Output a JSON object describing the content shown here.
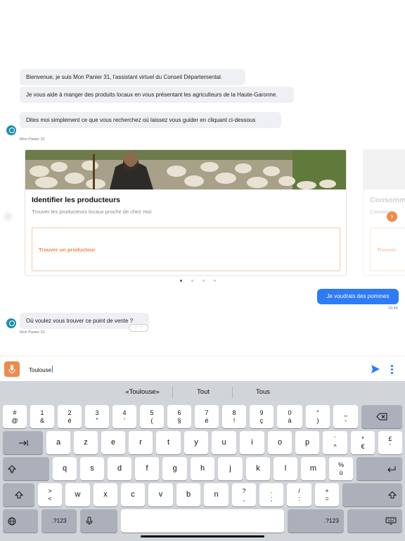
{
  "chat": {
    "bot_name": "Mon Panier 31",
    "messages": [
      {
        "text": "Bienvenue, je suis Mon Panier 31, l'assistant virtuel du Conseil Départemental."
      },
      {
        "text": "Je vous aide à manger des produits locaux en vous présentant les agriculteurs de la Haute-Garonne."
      },
      {
        "text": "Dites moi simplement ce que vous recherchez où laissez vous guider en cliquant ci-dessous"
      }
    ],
    "carousel": {
      "cards": [
        {
          "title": "Identifier les producteurs",
          "description": "Trouver les producteurs locaux proche de chez moi",
          "button": "Trouver un producteur"
        },
        {
          "title": "Consomm",
          "description": "Consom",
          "button": "Trouver"
        }
      ],
      "page_count": 4,
      "active_index": 0
    },
    "user_message": {
      "text": "Je voudrais des pommes",
      "time": "15:44"
    },
    "bot_reply": {
      "text": "Où voulez vous trouver ce point de vente ?"
    }
  },
  "input": {
    "value": "Toulouse"
  },
  "keyboard": {
    "suggestions": [
      "«Toulouse»",
      "Tout",
      "Tous"
    ],
    "row1": [
      [
        "#",
        "@"
      ],
      [
        "1",
        "&"
      ],
      [
        "2",
        "é"
      ],
      [
        "3",
        "\""
      ],
      [
        "4",
        "'"
      ],
      [
        "5",
        "("
      ],
      [
        "6",
        "§"
      ],
      [
        "7",
        "è"
      ],
      [
        "8",
        "!"
      ],
      [
        "9",
        "ç"
      ],
      [
        "0",
        "à"
      ],
      [
        "°",
        ")"
      ],
      [
        "_",
        "-"
      ]
    ],
    "row2": [
      "a",
      "z",
      "e",
      "r",
      "t",
      "y",
      "u",
      "i",
      "o",
      "p"
    ],
    "row2_extra": [
      [
        "¨",
        "^"
      ],
      [
        "*",
        "€"
      ],
      [
        "£",
        "`"
      ]
    ],
    "row3": [
      "q",
      "s",
      "d",
      "f",
      "g",
      "h",
      "j",
      "k",
      "l",
      "m"
    ],
    "row3_extra": [
      [
        "%",
        "ù"
      ]
    ],
    "row4_left": [
      [
        ">",
        "<"
      ]
    ],
    "row4": [
      "w",
      "x",
      "c",
      "v",
      "b",
      "n"
    ],
    "row4_extra": [
      [
        "?",
        ","
      ],
      [
        ".",
        ";"
      ],
      [
        "/",
        ":"
      ],
      [
        "+",
        "="
      ]
    ],
    "numbers_key": ".?123",
    "icons": {
      "delete": "delete-icon",
      "tab": "tab-icon",
      "caps": "caps-lock-icon",
      "shift": "shift-icon",
      "return": "return-icon",
      "globe": "globe-icon",
      "mic": "microphone-icon",
      "dismiss": "keyboard-dismiss-icon"
    }
  },
  "colors": {
    "accent_orange": "#f08a4b",
    "user_blue": "#2d7cf6",
    "bot_bubble": "#eff0f3"
  }
}
